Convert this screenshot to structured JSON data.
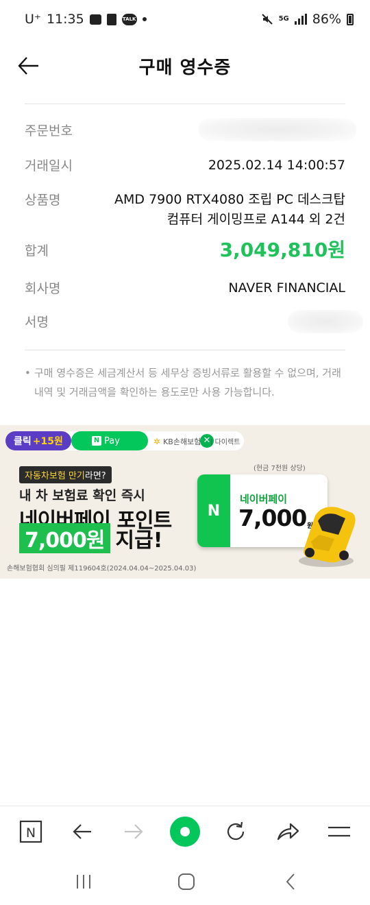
{
  "status_bar": {
    "carrier": "U⁺",
    "time": "11:35",
    "network": "5G",
    "battery": "86%"
  },
  "header": {
    "title": "구매 영수증"
  },
  "receipt": {
    "order_number": {
      "label": "주문번호",
      "value": ""
    },
    "transaction_date": {
      "label": "거래일시",
      "value": "2025.02.14 14:00:57"
    },
    "product_name": {
      "label": "상품명",
      "value_line1": "AMD 7900 RTX4080 조립 PC 데스크탑",
      "value_line2": "컴퓨터 게이밍프로 A144 외 2건"
    },
    "total": {
      "label": "합계",
      "value": "3,049,810원"
    },
    "company": {
      "label": "회사명",
      "value": "NAVER FINANCIAL"
    },
    "signature": {
      "label": "서명",
      "value": ""
    }
  },
  "note": "구매 영수증은 세금계산서 등 세무상 증빙서류로 활용할 수 없으며, 거래내역 및 거래금액을 확인하는 용도로만 사용 가능합니다.",
  "ad": {
    "click_reward": "클릭",
    "click_plus": "+15원",
    "npay_n": "N",
    "npay_label": "Pay",
    "close": "✕",
    "kb_logo": "KB손해보험",
    "separator": "|",
    "direct": "다이렉트",
    "badge_part1": "자동차보험 만기",
    "badge_part2": "라면?",
    "line1": "내 차 보험료 확인 즉시",
    "line2": "네이버페이 포인트",
    "amount": "7,000원",
    "line3_suffix": "지급!",
    "cash_note": "(현금 7천원 상당)",
    "card_n": "N",
    "card_title": "네이버페이",
    "card_amount": "7,000",
    "card_unit": "원",
    "footnote": "손해보험협회 심의필 제119604호(2024.04.04~2025.04.03)"
  },
  "colors": {
    "naver_green": "#03c75a",
    "total_green": "#1fc15a",
    "label_gray": "#888888",
    "click_purple": "#5b3cc4"
  },
  "toolbar": {
    "icons": [
      "naver-n-icon",
      "back-arrow-icon",
      "forward-arrow-icon",
      "home-green-icon",
      "refresh-icon",
      "share-icon",
      "menu-icon"
    ],
    "naver_n": "N"
  },
  "system_nav": {
    "icons": [
      "recent-apps-icon",
      "home-icon",
      "back-icon"
    ]
  }
}
